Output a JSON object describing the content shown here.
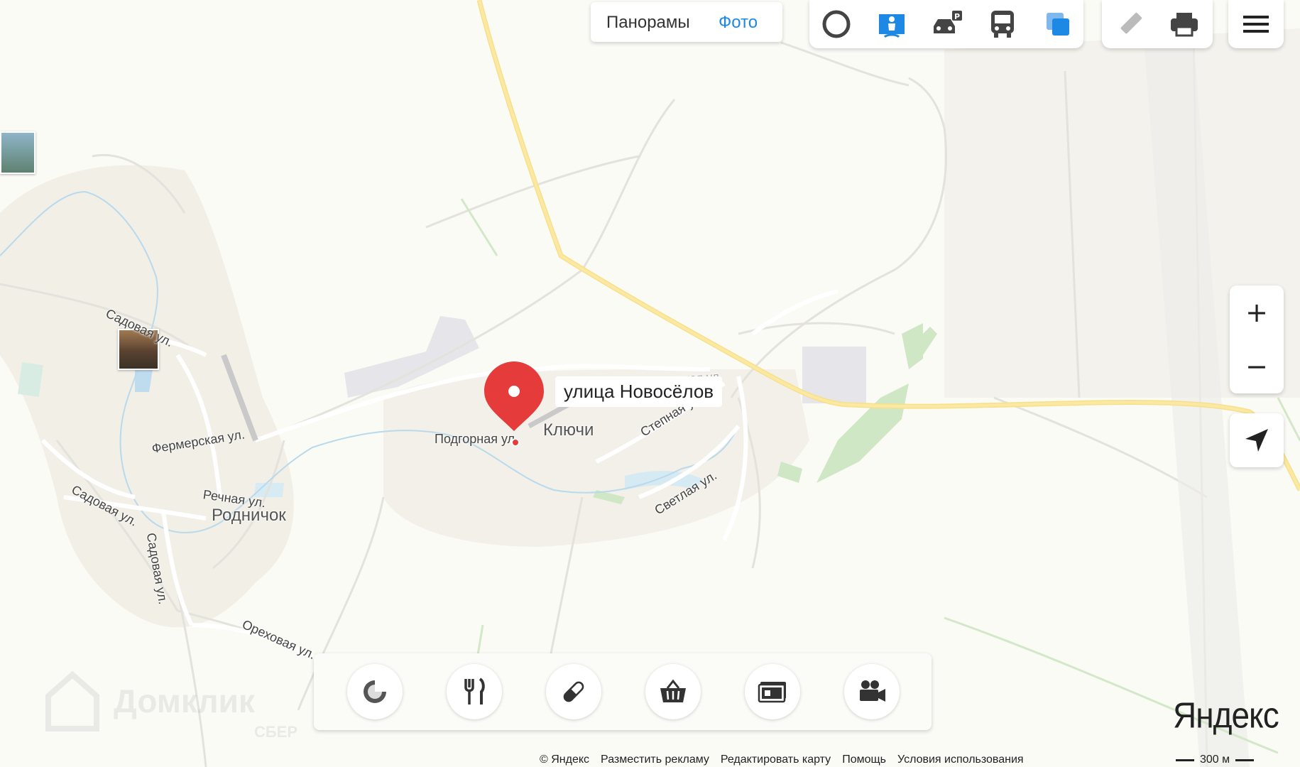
{
  "top_bar": {
    "panoramas_label": "Панорамы",
    "photo_label": "Фото"
  },
  "layers": {
    "icons": [
      "traffic-ring-icon",
      "panorama-person-icon",
      "parking-car-icon",
      "transport-bus-icon",
      "layers-icon"
    ],
    "accent_color": "#1e88e5"
  },
  "tools": {
    "icons": [
      "ruler-icon",
      "printer-icon",
      "menu-icon"
    ]
  },
  "zoom": {
    "plus": "+",
    "minus": "−"
  },
  "marker": {
    "label": "улица Новосёлов",
    "color": "#e63b3b"
  },
  "places": {
    "settlements": [
      "Ключи",
      "Родничок"
    ],
    "streets": [
      "Подгорная ул.",
      "Крымская ул.",
      "Степная ул.",
      "Светлая ул.",
      "Фермерская ул.",
      "Речная ул.",
      "Садовая ул.",
      "Садовая ул.",
      "Садовая ул.",
      "Ореховая ул."
    ]
  },
  "categories": [
    "gas-station-icon",
    "restaurant-icon",
    "pharmacy-icon",
    "shop-basket-icon",
    "atm-icon",
    "cinema-icon"
  ],
  "watermark": {
    "brand": "Домклик",
    "sub": "СБЕР"
  },
  "logo": "Яндекс",
  "scale": {
    "label": "300 м"
  },
  "footer": {
    "links": [
      "© Яндекс",
      "Разместить рекламу",
      "Редактировать карту",
      "Помощь",
      "Условия использования"
    ]
  }
}
